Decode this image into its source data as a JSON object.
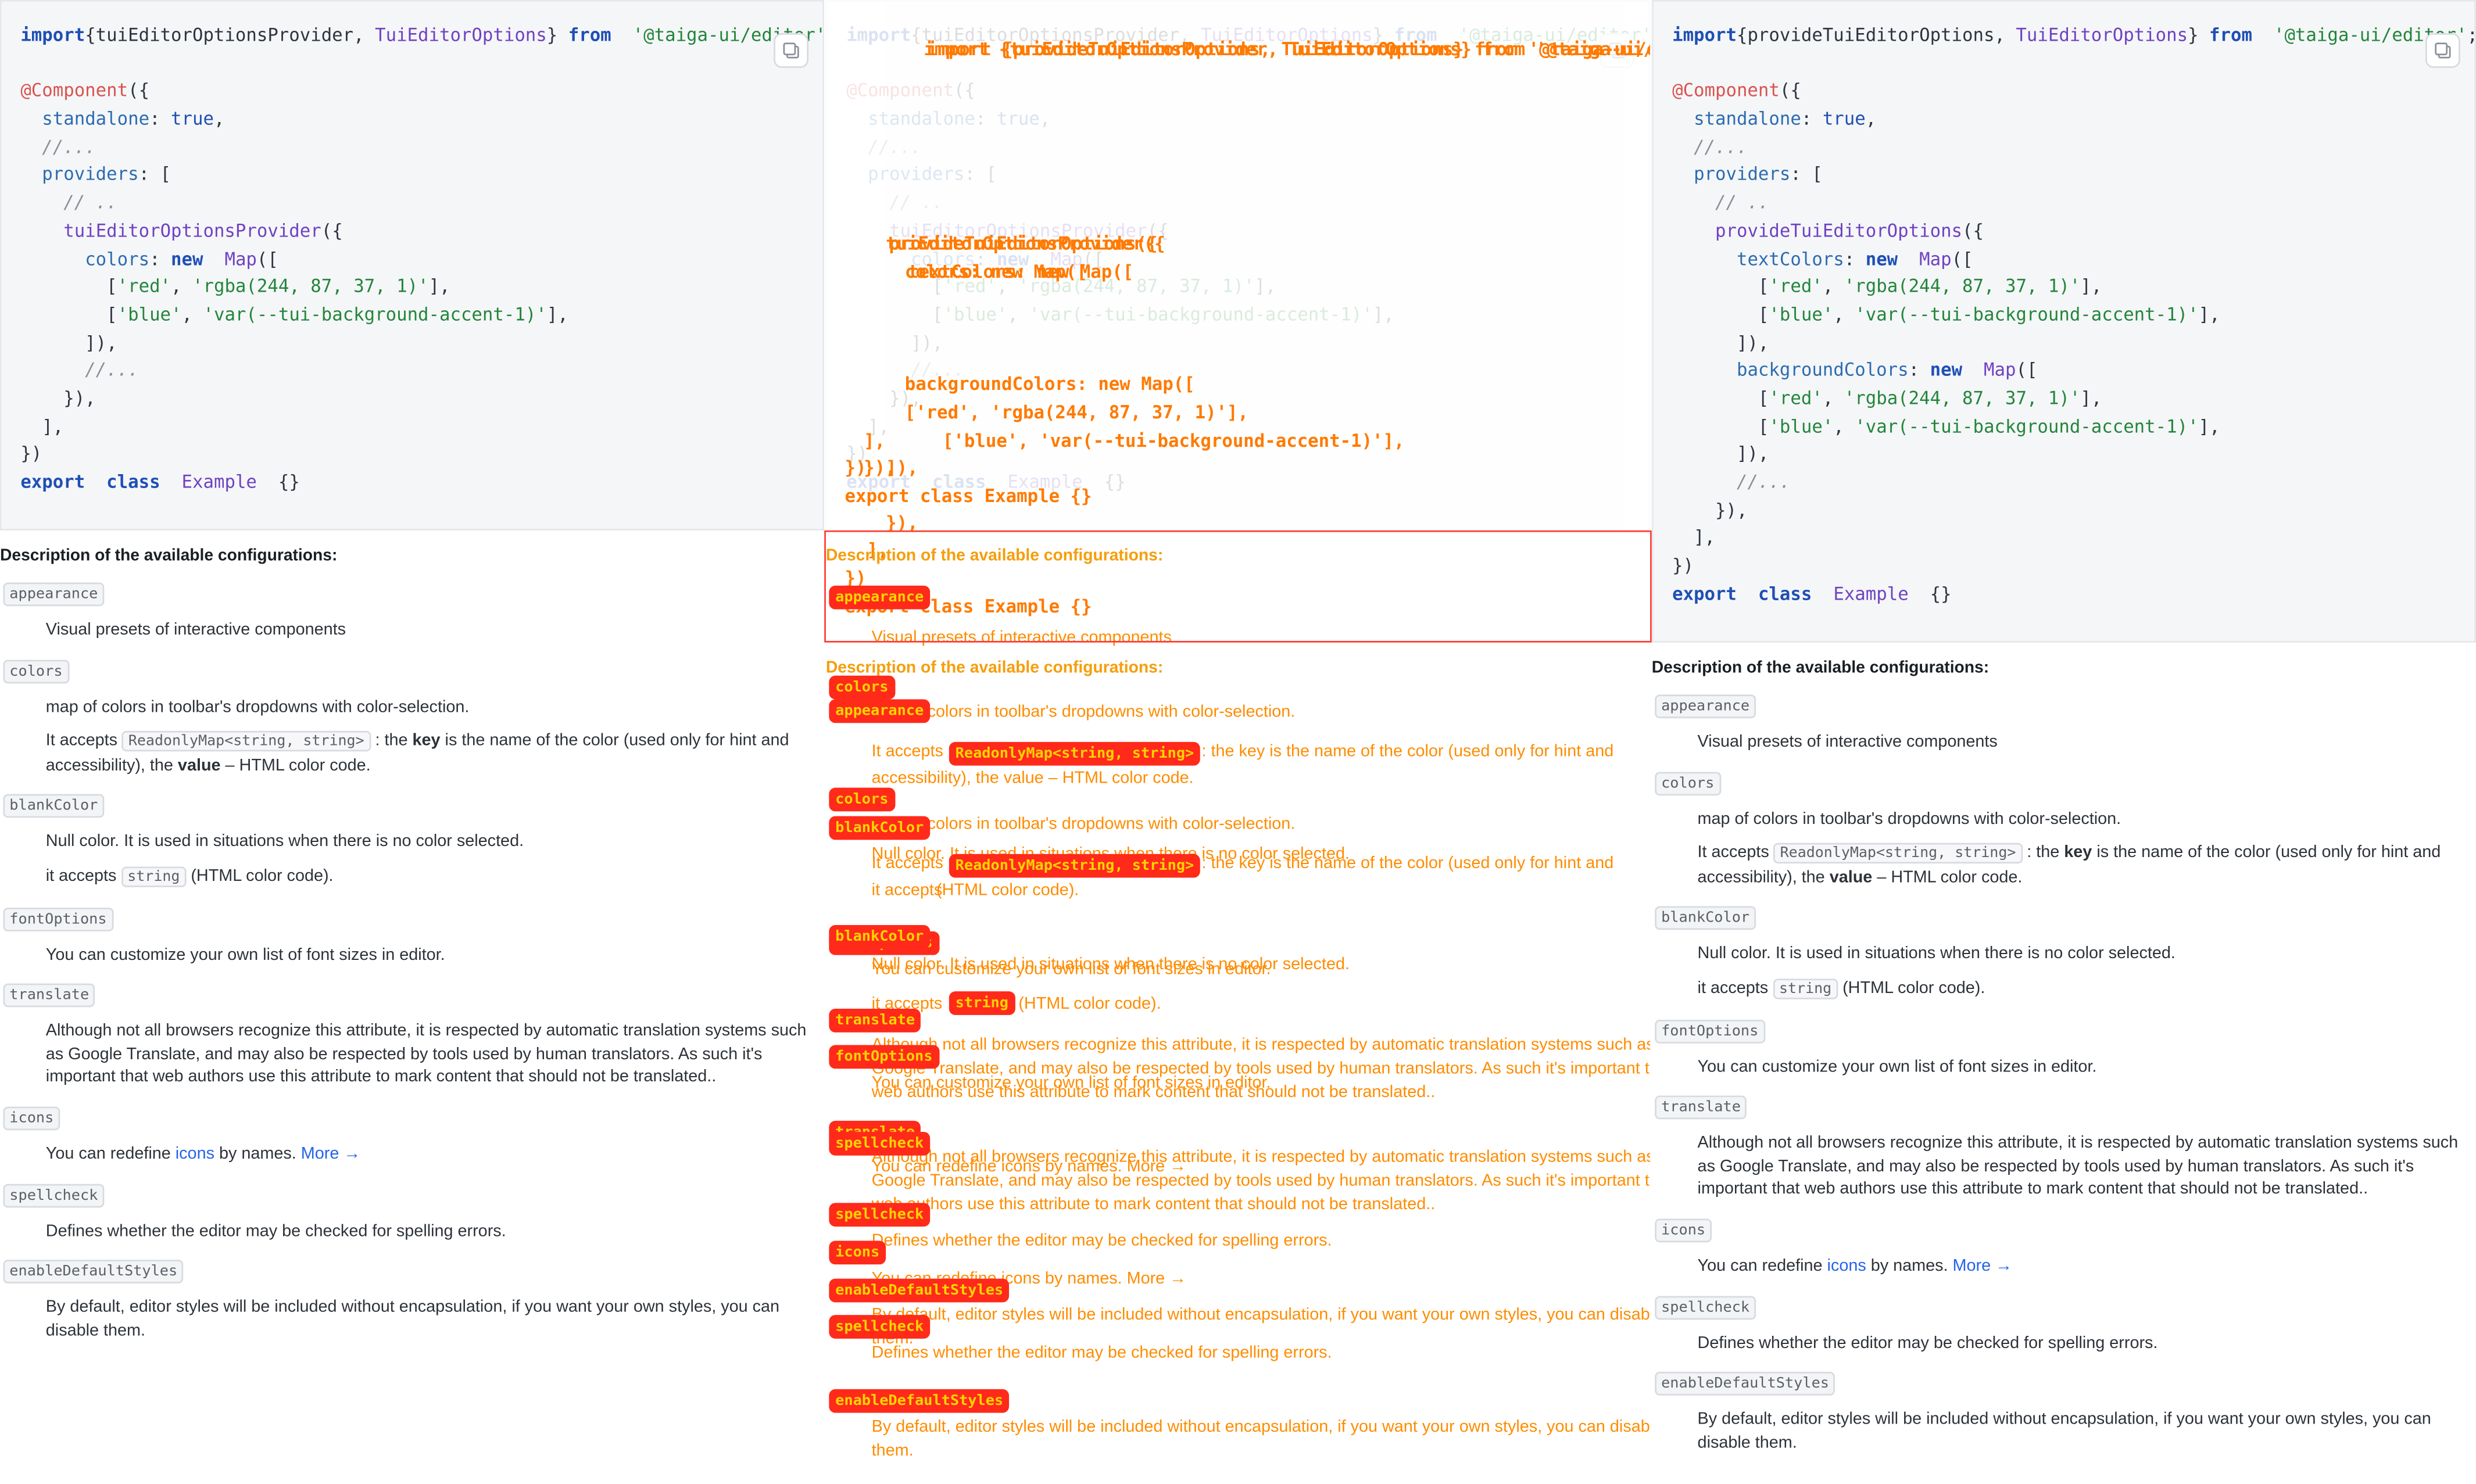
{
  "left": {
    "code": [
      [
        [
          "k-kw",
          "import"
        ],
        [
          "",
          "{tuiEditorOptionsProvider, "
        ],
        [
          "k-ty",
          "TuiEditorOptions"
        ],
        [
          "",
          "} "
        ],
        [
          "k-kw",
          "from"
        ],
        [
          "",
          "  "
        ],
        [
          "k-str",
          "'@taiga-ui/editor'"
        ],
        [
          "",
          ";"
        ]
      ],
      [],
      [
        [
          "k-dec",
          "@Component"
        ],
        [
          "",
          "({"
        ]
      ],
      [
        [
          "",
          "  "
        ],
        [
          "k-prop",
          "standalone"
        ],
        [
          "",
          ": "
        ],
        [
          "k-bool",
          "true"
        ],
        [
          "",
          ","
        ]
      ],
      [
        [
          "",
          "  "
        ],
        [
          "k-com",
          "//..."
        ]
      ],
      [
        [
          "",
          "  "
        ],
        [
          "k-prop",
          "providers"
        ],
        [
          "",
          ": ["
        ]
      ],
      [
        [
          "",
          "    "
        ],
        [
          "k-com",
          "// .."
        ]
      ],
      [
        [
          "",
          "    "
        ],
        [
          "k-fn",
          "tuiEditorOptionsProvider"
        ],
        [
          "",
          "({"
        ]
      ],
      [
        [
          "",
          "      "
        ],
        [
          "k-prop",
          "colors"
        ],
        [
          "",
          ": "
        ],
        [
          "k-kw",
          "new"
        ],
        [
          "",
          "  "
        ],
        [
          "k-ty",
          "Map"
        ],
        [
          "",
          "(["
        ]
      ],
      [
        [
          "",
          "        ["
        ],
        [
          "k-str",
          "'red'"
        ],
        [
          "",
          ", "
        ],
        [
          "k-str",
          "'rgba(244, 87, 37, 1)'"
        ],
        [
          "",
          "],"
        ]
      ],
      [
        [
          "",
          "        ["
        ],
        [
          "k-str",
          "'blue'"
        ],
        [
          "",
          ", "
        ],
        [
          "k-str",
          "'var(--tui-background-accent-1)'"
        ],
        [
          "",
          "],"
        ]
      ],
      [
        [
          "",
          "      ]),"
        ]
      ],
      [
        [
          "",
          "      "
        ],
        [
          "k-com",
          "//..."
        ]
      ],
      [
        [
          "",
          "    }),"
        ]
      ],
      [
        [
          "",
          "  ],"
        ]
      ],
      [
        [
          "",
          "})"
        ]
      ],
      [
        [
          "k-kw",
          "export"
        ],
        [
          "",
          "  "
        ],
        [
          "k-kw",
          "class"
        ],
        [
          "",
          "  "
        ],
        [
          "k-ty",
          "Example"
        ],
        [
          "",
          "  {}"
        ]
      ]
    ]
  },
  "right": {
    "code": [
      [
        [
          "k-kw",
          "import"
        ],
        [
          "",
          "{provideTuiEditorOptions, "
        ],
        [
          "k-ty",
          "TuiEditorOptions"
        ],
        [
          "",
          "} "
        ],
        [
          "k-kw",
          "from"
        ],
        [
          "",
          "  "
        ],
        [
          "k-str",
          "'@taiga-ui/editor'"
        ],
        [
          "",
          ";"
        ]
      ],
      [],
      [
        [
          "k-dec",
          "@Component"
        ],
        [
          "",
          "({"
        ]
      ],
      [
        [
          "",
          "  "
        ],
        [
          "k-prop",
          "standalone"
        ],
        [
          "",
          ": "
        ],
        [
          "k-bool",
          "true"
        ],
        [
          "",
          ","
        ]
      ],
      [
        [
          "",
          "  "
        ],
        [
          "k-com",
          "//..."
        ]
      ],
      [
        [
          "",
          "  "
        ],
        [
          "k-prop",
          "providers"
        ],
        [
          "",
          ": ["
        ]
      ],
      [
        [
          "",
          "    "
        ],
        [
          "k-com",
          "// .."
        ]
      ],
      [
        [
          "",
          "    "
        ],
        [
          "k-fn",
          "provideTuiEditorOptions"
        ],
        [
          "",
          "({"
        ]
      ],
      [
        [
          "",
          "      "
        ],
        [
          "k-prop",
          "textColors"
        ],
        [
          "",
          ": "
        ],
        [
          "k-kw",
          "new"
        ],
        [
          "",
          "  "
        ],
        [
          "k-ty",
          "Map"
        ],
        [
          "",
          "(["
        ]
      ],
      [
        [
          "",
          "        ["
        ],
        [
          "k-str",
          "'red'"
        ],
        [
          "",
          ", "
        ],
        [
          "k-str",
          "'rgba(244, 87, 37, 1)'"
        ],
        [
          "",
          "],"
        ]
      ],
      [
        [
          "",
          "        ["
        ],
        [
          "k-str",
          "'blue'"
        ],
        [
          "",
          ", "
        ],
        [
          "k-str",
          "'var(--tui-background-accent-1)'"
        ],
        [
          "",
          "],"
        ]
      ],
      [
        [
          "",
          "      ]),"
        ]
      ],
      [
        [
          "",
          "      "
        ],
        [
          "k-prop",
          "backgroundColors"
        ],
        [
          "",
          ": "
        ],
        [
          "k-kw",
          "new"
        ],
        [
          "",
          "  "
        ],
        [
          "k-ty",
          "Map"
        ],
        [
          "",
          "(["
        ]
      ],
      [
        [
          "",
          "        ["
        ],
        [
          "k-str",
          "'red'"
        ],
        [
          "",
          ", "
        ],
        [
          "k-str",
          "'rgba(244, 87, 37, 1)'"
        ],
        [
          "",
          "],"
        ]
      ],
      [
        [
          "",
          "        ["
        ],
        [
          "k-str",
          "'blue'"
        ],
        [
          "",
          ", "
        ],
        [
          "k-str",
          "'var(--tui-background-accent-1)'"
        ],
        [
          "",
          "],"
        ]
      ],
      [
        [
          "",
          "      ]),"
        ]
      ],
      [
        [
          "",
          "      "
        ],
        [
          "k-com",
          "//..."
        ]
      ],
      [
        [
          "",
          "    }),"
        ]
      ],
      [
        [
          "",
          "  ],"
        ]
      ],
      [
        [
          "",
          "})"
        ]
      ],
      [
        [
          "k-kw",
          "export"
        ],
        [
          "",
          "  "
        ],
        [
          "k-kw",
          "class"
        ],
        [
          "",
          "  "
        ],
        [
          "k-ty",
          "Example"
        ],
        [
          "",
          "  {}"
        ]
      ]
    ]
  },
  "desc_title": "Description of the available configurations:",
  "left_options": [
    {
      "name": "appearance",
      "paras": [
        [
          {
            "t": "Visual presets of interactive components"
          }
        ]
      ]
    },
    {
      "name": "colors",
      "paras": [
        [
          {
            "t": "map of colors in toolbar's dropdowns with color-selection."
          }
        ],
        [
          {
            "t": "It accepts "
          },
          {
            "c": "ReadonlyMap<string, string>"
          },
          {
            "t": " : the "
          },
          {
            "b": "key"
          },
          {
            "t": " is the name of the color (used only for hint and accessibility), the "
          },
          {
            "b": "value"
          },
          {
            "t": " – HTML color code."
          }
        ]
      ]
    },
    {
      "name": "blankColor",
      "paras": [
        [
          {
            "t": "Null color. It is used in situations when there is no color selected."
          }
        ],
        [
          {
            "t": "it accepts "
          },
          {
            "c": "string"
          },
          {
            "t": " (HTML color code)."
          }
        ]
      ]
    },
    {
      "name": "fontOptions",
      "paras": [
        [
          {
            "t": "You can customize your own list of font sizes in editor."
          }
        ]
      ]
    },
    {
      "name": "translate",
      "paras": [
        [
          {
            "t": "Although not all browsers recognize this attribute, it is respected by automatic translation systems such as Google Translate, and may also be respected by tools used by human translators. As such it's important that web authors use this attribute to mark content that should not be translated.."
          }
        ]
      ]
    },
    {
      "name": "icons",
      "paras": [
        [
          {
            "t": "You can redefine "
          },
          {
            "l": "icons"
          },
          {
            "t": " by names. "
          },
          {
            "l": "More →"
          }
        ]
      ]
    },
    {
      "name": "spellcheck",
      "paras": [
        [
          {
            "t": "Defines whether the editor may be checked for spelling errors."
          }
        ]
      ]
    },
    {
      "name": "enableDefaultStyles",
      "paras": [
        [
          {
            "t": "By default, editor styles will be included without encapsulation, if you want your own styles, you can disable them."
          }
        ]
      ]
    }
  ],
  "right_options": [
    {
      "name": "appearance",
      "paras": [
        [
          {
            "t": "Visual presets of interactive components"
          }
        ]
      ]
    },
    {
      "name": "colors",
      "paras": [
        [
          {
            "t": "map of colors in toolbar's dropdowns with color-selection."
          }
        ],
        [
          {
            "t": "It accepts "
          },
          {
            "c": "ReadonlyMap<string, string>"
          },
          {
            "t": " : the "
          },
          {
            "b": "key"
          },
          {
            "t": " is the name of the color (used only for hint and accessibility), the "
          },
          {
            "b": "value"
          },
          {
            "t": " – HTML color code."
          }
        ]
      ]
    },
    {
      "name": "blankColor",
      "paras": [
        [
          {
            "t": "Null color. It is used in situations when there is no color selected."
          }
        ],
        [
          {
            "t": "it accepts "
          },
          {
            "c": "string"
          },
          {
            "t": " (HTML color code)."
          }
        ]
      ]
    },
    {
      "name": "fontOptions",
      "paras": [
        [
          {
            "t": "You can customize your own list of font sizes in editor."
          }
        ]
      ]
    },
    {
      "name": "translate",
      "paras": [
        [
          {
            "t": "Although not all browsers recognize this attribute, it is respected by automatic translation systems such as Google Translate, and may also be respected by tools used by human translators. As such it's important that web authors use this attribute to mark content that should not be translated.."
          }
        ]
      ]
    },
    {
      "name": "icons",
      "paras": [
        [
          {
            "t": "You can redefine "
          },
          {
            "l": "icons"
          },
          {
            "t": " by names. "
          },
          {
            "l": "More →"
          }
        ]
      ]
    },
    {
      "name": "spellcheck",
      "paras": [
        [
          {
            "t": "Defines whether the editor may be checked for spelling errors."
          }
        ]
      ]
    },
    {
      "name": "enableDefaultStyles",
      "paras": [
        [
          {
            "t": "By default, editor styles will be included without encapsulation, if you want your own styles, you can disable them."
          }
        ]
      ]
    }
  ],
  "middle": {
    "code_lines": [
      "import {tuiEditorOptionsProvider, TuiEditorOptions} from '@taiga-ui/editor';",
      "import {provideTuiEditorOptions, TuiEditorOptions} from '@taiga-ui/editor';",
      "tuiEditorOptionsProvider({",
      "provideTuiEditorOptions({",
      "colors: new Map([",
      "textColors: new Map([",
      "backgroundColors: new Map([",
      "['red', 'rgba(244, 87, 37, 1)'],",
      "['blue', 'var(--tui-background-accent-1)'],",
      "]),",
      "}),",
      "],",
      "})",
      "export class Example {}",
      "//..."
    ],
    "text_lines": [
      "Visual presets of interactive components",
      "map of colors in toolbar's dropdowns with color-selection.",
      "It accepts",
      ": the key is the name of the color (used only for hint and",
      "accessibility), the value – HTML color code.",
      "Null color. It is used in situations when there is no color selected.",
      "it accepts",
      "(HTML color code).",
      "You can customize your own list of font sizes in editor.",
      "Although not all browsers recognize this attribute, it is respected by automatic translation systems such as",
      "Google Translate, and may also be respected by tools used by human translators. As such it's important that",
      "web authors use this attribute to mark content that should not be translated..",
      "You can redefine icons by names. More →",
      "Defines whether the editor may be checked for spelling errors.",
      "By default, editor styles will be included without encapsulation, if you want your own styles, you can disable",
      "them."
    ],
    "tags": [
      "appearance",
      "colors",
      "blankColor",
      "fontOptions",
      "translate",
      "icons",
      "spellcheck",
      "enableDefaultStyles",
      "ReadonlyMap<string, string>",
      "string"
    ]
  },
  "colors": {
    "overlay_text": "#ff8c00",
    "overlay_tag_bg": "#ff2a1a",
    "overlay_tag_text": "#ffd400",
    "frame": "#ff3b30"
  }
}
